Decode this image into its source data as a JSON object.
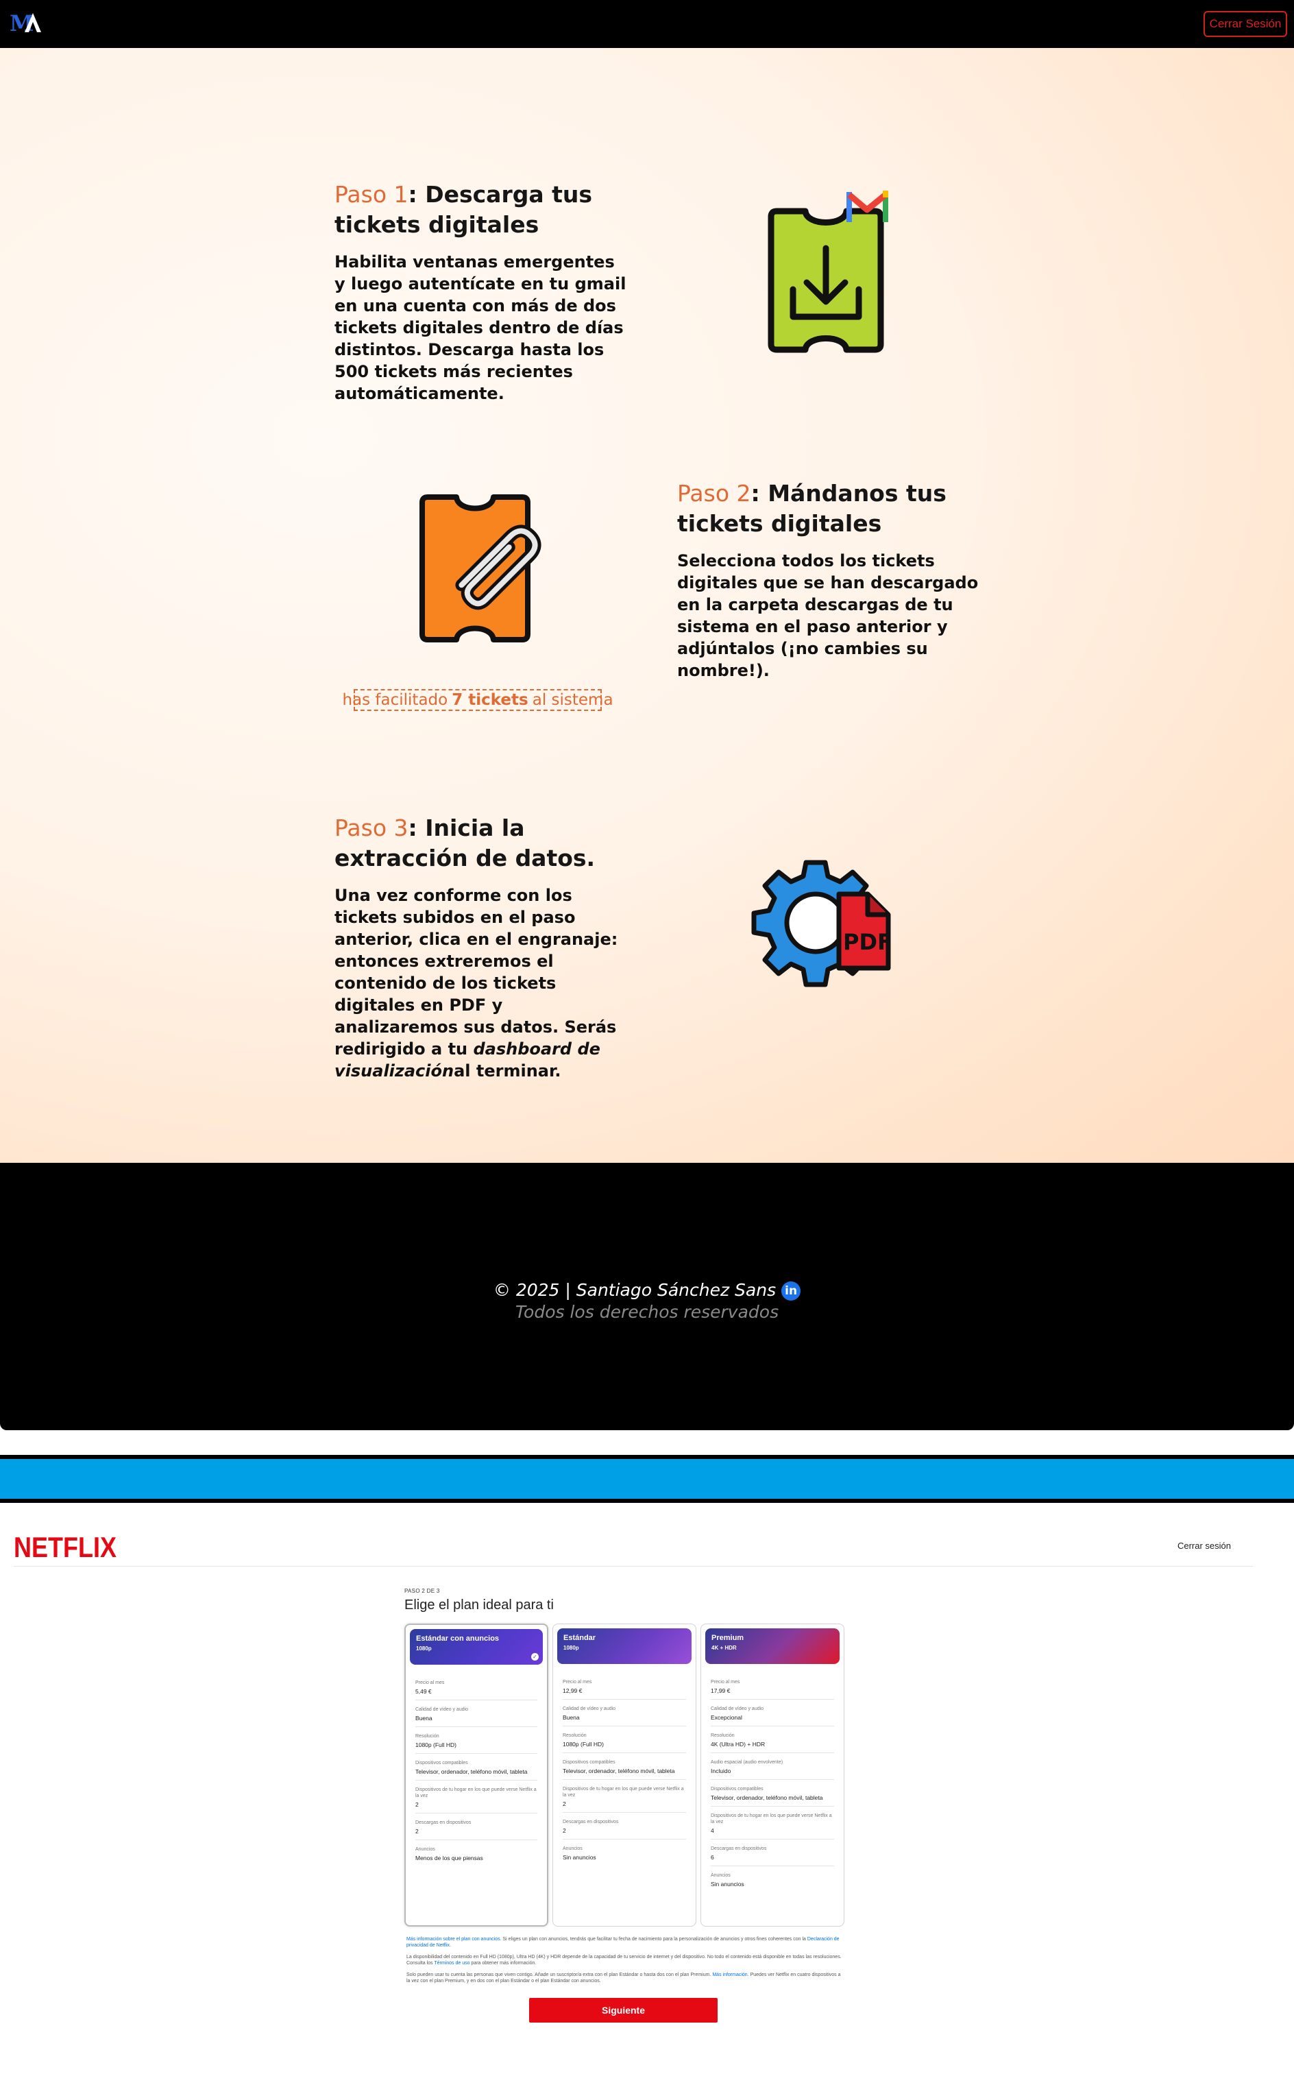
{
  "app": {
    "logo_text": "MA",
    "logout_label": "Cerrar Sesión"
  },
  "steps": [
    {
      "number": "Paso 1",
      "title_rest": ": Descarga tus tickets digitales",
      "text": "Habilita ventanas emergentes y luego autentícate en tu gmail en una cuenta con más de dos tickets digitales dentro de días distintos. Descarga hasta los 500 tickets más recientes automáticamente."
    },
    {
      "number": "Paso 2",
      "title_rest": ": Mándanos tus tickets digitales",
      "text": "Selecciona todos los tickets digitales que se han descargado en la carpeta descargas de tu sistema en el paso anterior y adjúntalos (¡no cambies su nombre!)."
    },
    {
      "number": "Paso 3",
      "title_rest": ": Inicia la extracción de datos.",
      "text_before": "Una vez conforme con los tickets subidos en el paso anterior, clica en el engranaje: entonces extreremos el contenido de los tickets digitales en PDF y analizaremos sus datos. Serás redirigido a tu ",
      "text_em": "dashboard de visualización",
      "text_after": "al terminar."
    }
  ],
  "upload_status": {
    "prefix": "has facilitado",
    "count": "7 tickets",
    "suffix": "al sistema"
  },
  "icons": {
    "ticket_download": "ticket-download-icon",
    "gmail": "gmail-icon",
    "ticket_attach": "ticket-paperclip-icon",
    "gear_pdf": "gear-pdf-icon",
    "pdf_label": "PDF",
    "linkedin": "in"
  },
  "footer": {
    "copyright": "© 2025 | Santiago Sánchez Sans",
    "rights": "Todos los derechos reservados"
  },
  "colors": {
    "accent_orange": "#e06a33",
    "ticket_green": "#b4d433",
    "ticket_orange": "#f7841e",
    "gear_blue": "#2a8ee0",
    "pdf_red": "#e4202a",
    "netflix_red": "#e50914",
    "band_blue": "#00a0e6"
  },
  "netflix": {
    "logo": "NETFLIX",
    "logout": "Cerrar sesión",
    "step": "PASO 2 DE 3",
    "heading": "Elige el plan ideal para ti",
    "plans": [
      {
        "name": "Estándar con anuncios",
        "resolution_badge": "1080p",
        "selected": true,
        "rows": [
          {
            "k": "Precio al mes",
            "v": "5,49 €"
          },
          {
            "k": "Calidad de vídeo y audio",
            "v": "Buena"
          },
          {
            "k": "Resolución",
            "v": "1080p (Full HD)"
          },
          {
            "k": "Dispositivos compatibles",
            "v": "Televisor, ordenador, teléfono móvil, tableta"
          },
          {
            "k": "Dispositivos de tu hogar en los que puede verse Netflix a la vez",
            "v": "2"
          },
          {
            "k": "Descargas en dispositivos",
            "v": "2"
          },
          {
            "k": "Anuncios",
            "v": "Menos de los que piensas"
          }
        ]
      },
      {
        "name": "Estándar",
        "resolution_badge": "1080p",
        "selected": false,
        "rows": [
          {
            "k": "Precio al mes",
            "v": "12,99 €"
          },
          {
            "k": "Calidad de vídeo y audio",
            "v": "Buena"
          },
          {
            "k": "Resolución",
            "v": "1080p (Full HD)"
          },
          {
            "k": "Dispositivos compatibles",
            "v": "Televisor, ordenador, teléfono móvil, tableta"
          },
          {
            "k": "Dispositivos de tu hogar en los que puede verse Netflix a la vez",
            "v": "2"
          },
          {
            "k": "Descargas en dispositivos",
            "v": "2"
          },
          {
            "k": "Anuncios",
            "v": "Sin anuncios"
          }
        ]
      },
      {
        "name": "Premium",
        "resolution_badge": "4K + HDR",
        "selected": false,
        "rows": [
          {
            "k": "Precio al mes",
            "v": "17,99 €"
          },
          {
            "k": "Calidad de vídeo y audio",
            "v": "Excepcional"
          },
          {
            "k": "Resolución",
            "v": "4K (Ultra HD) + HDR"
          },
          {
            "k": "Audio espacial (audio envolvente)",
            "v": "Incluido"
          },
          {
            "k": "Dispositivos compatibles",
            "v": "Televisor, ordenador, teléfono móvil, tableta"
          },
          {
            "k": "Dispositivos de tu hogar en los que puede verse Netflix a la vez",
            "v": "4"
          },
          {
            "k": "Descargas en dispositivos",
            "v": "6"
          },
          {
            "k": "Anuncios",
            "v": "Sin anuncios"
          }
        ]
      }
    ],
    "fine_print": {
      "p1_link": "Más información sobre el plan con anuncios.",
      "p1_text": " Si eliges un plan con anuncios, tendrás que facilitar tu fecha de nacimiento para la personalización de anuncios y otros fines coherentes con la ",
      "p1_link2": "Declaración de privacidad de Netflix",
      "p1_end": ".",
      "p2_text": "La disponibilidad del contenido en Full HD (1080p), Ultra HD (4K) y HDR depende de la capacidad de tu servicio de internet y del dispositivo. No todo el contenido está disponible en todas las resoluciones. Consulta los ",
      "p2_link": "Términos de uso",
      "p2_end": " para obtener más información.",
      "p3_text": "Solo pueden usar tu cuenta las personas que viven contigo. Añade un suscriptor/a extra con el plan Estándar o hasta dos con el plan Premium. ",
      "p3_link": "Más información",
      "p3_end": ". Puedes ver Netflix en cuatro dispositivos a la vez con el plan Premium, y en dos con el plan Estándar o el plan Estándar con anuncios."
    },
    "next_label": "Siguiente"
  }
}
